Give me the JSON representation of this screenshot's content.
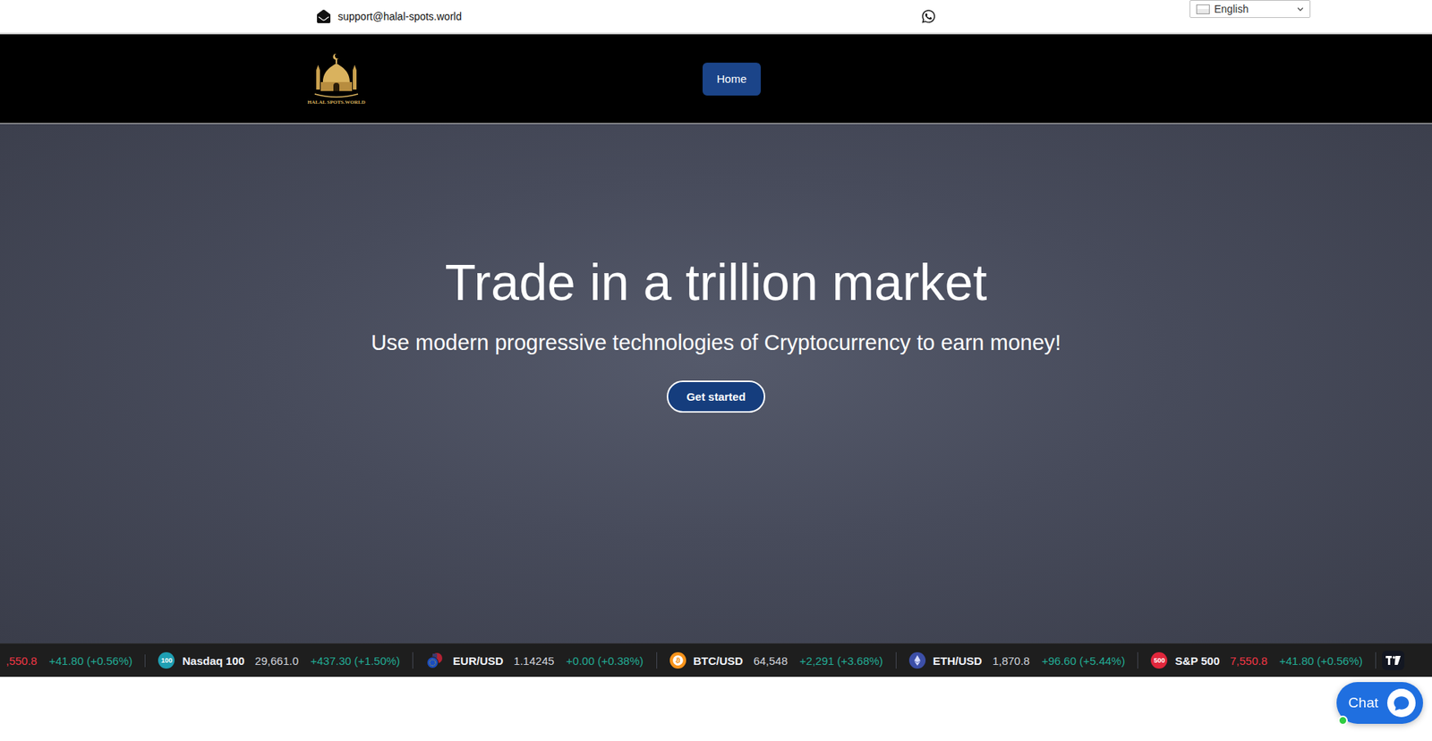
{
  "topbar": {
    "email": "support@halal-spots.world",
    "language": "English"
  },
  "nav": {
    "logo_text": "HALAL SPOTS.WORLD",
    "items": [
      {
        "label": "Home",
        "selected": true
      }
    ]
  },
  "hero": {
    "title": "Trade in a trillion market",
    "subtitle": "Use modern progressive technologies of Cryptocurrency to earn money!",
    "button": "Get started"
  },
  "ticker": {
    "items": [
      {
        "kind": "cut",
        "name": "",
        "badge": "",
        "badge_color": "",
        "value": ",550.8",
        "color": "#f23645",
        "change": "+41.80 (+0.56%)",
        "direction": "up"
      },
      {
        "kind": "badge",
        "name": "Nasdaq 100",
        "badge": "100",
        "badge_color": "#1e9fb3",
        "value": "29,661.0",
        "color": "#d1d4dc",
        "change": "+437.30 (+1.50%)",
        "direction": "up"
      },
      {
        "kind": "flags",
        "name": "EUR/USD",
        "badge": "",
        "badge_color": "",
        "value": "1.14245",
        "color": "#d1d4dc",
        "change": "+0.00 (+0.38%)",
        "direction": "up"
      },
      {
        "kind": "btc",
        "name": "BTC/USD",
        "badge": "",
        "badge_color": "",
        "value": "64,548",
        "color": "#d1d4dc",
        "change": "+2,291 (+3.68%)",
        "direction": "up"
      },
      {
        "kind": "eth",
        "name": "ETH/USD",
        "badge": "",
        "badge_color": "",
        "value": "1,870.8",
        "color": "#d1d4dc",
        "change": "+96.60 (+5.44%)",
        "direction": "up"
      },
      {
        "kind": "badge",
        "name": "S&P 500",
        "badge": "500",
        "badge_color": "#e0263b",
        "value": "7,550.8",
        "color": "#f23645",
        "change": "+41.80 (+0.56%)",
        "direction": "up"
      }
    ]
  },
  "chat": {
    "label": "Chat",
    "online": true
  }
}
